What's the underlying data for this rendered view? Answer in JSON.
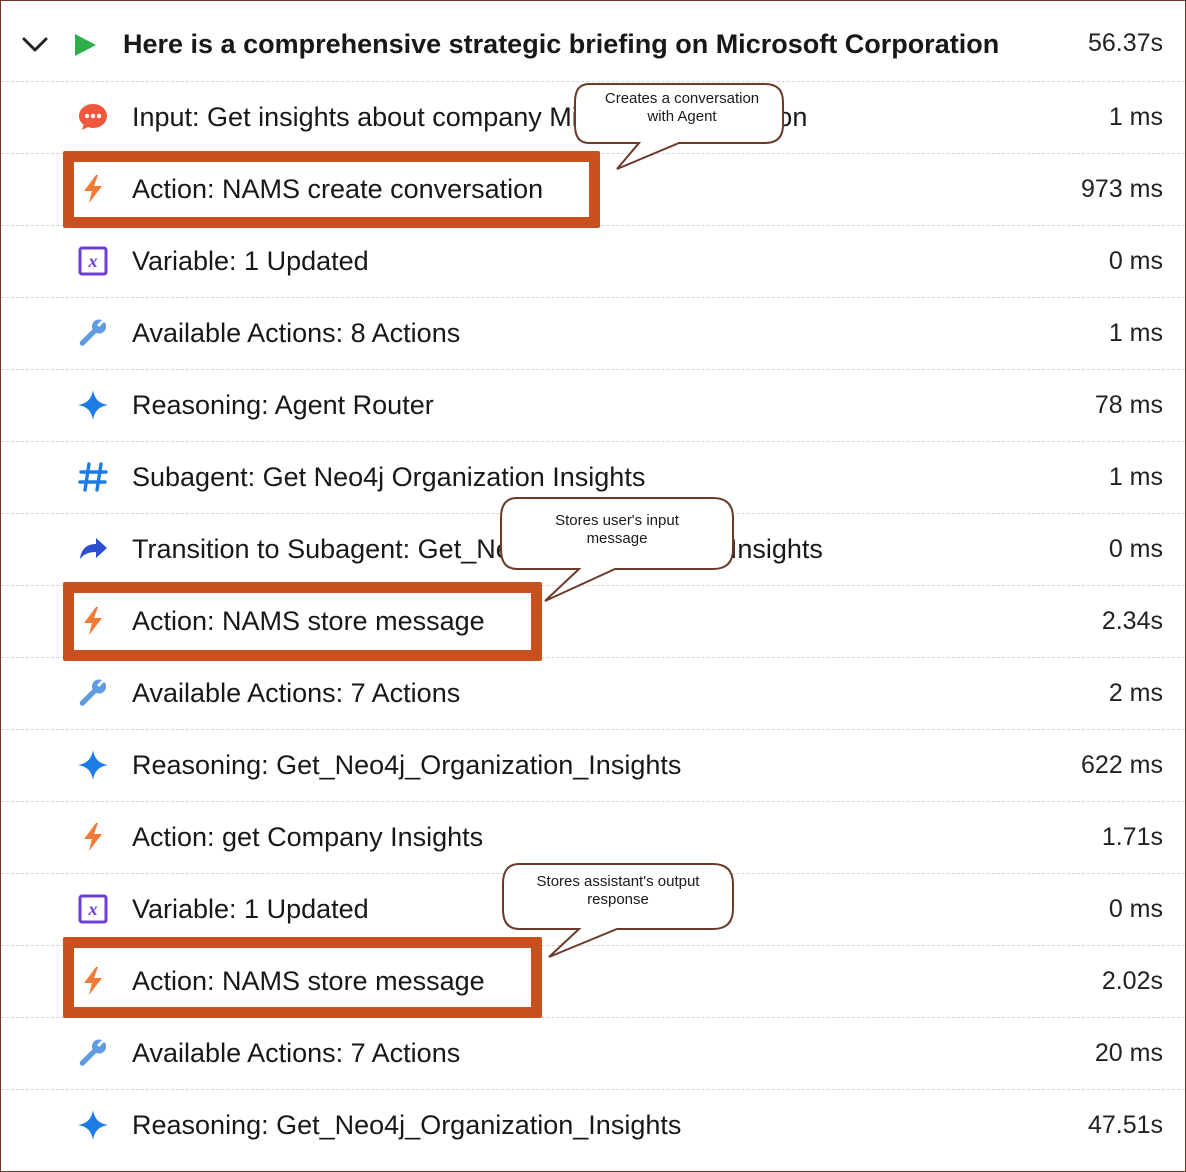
{
  "header": {
    "title": "Here is a comprehensive strategic briefing on Microsoft Corporation",
    "time": "56.37s",
    "expand_icon": "chevron-down-icon",
    "run_icon": "play-icon"
  },
  "rows": [
    {
      "label": "Input: Get insights about company Microsoft Corporation",
      "time": "1 ms",
      "icon": "chat-icon"
    },
    {
      "label": "Action: NAMS create conversation",
      "time": "973 ms",
      "icon": "lightning-icon"
    },
    {
      "label": "Variable: 1 Updated",
      "time": "0 ms",
      "icon": "variable-icon"
    },
    {
      "label": "Available Actions: 8 Actions",
      "time": "1 ms",
      "icon": "wrench-icon"
    },
    {
      "label": "Reasoning: Agent Router",
      "time": "78 ms",
      "icon": "sparkle-icon"
    },
    {
      "label": "Subagent: Get Neo4j Organization Insights",
      "time": "1 ms",
      "icon": "hash-icon"
    },
    {
      "label": "Transition to Subagent: Get_Neo4j_Organization_Insights",
      "time": "0 ms",
      "icon": "redirect-arrow-icon"
    },
    {
      "label": "Action: NAMS store message",
      "time": "2.34s",
      "icon": "lightning-icon"
    },
    {
      "label": "Available Actions: 7 Actions",
      "time": "2 ms",
      "icon": "wrench-icon"
    },
    {
      "label": "Reasoning: Get_Neo4j_Organization_Insights",
      "time": "622 ms",
      "icon": "sparkle-icon"
    },
    {
      "label": "Action: get Company Insights",
      "time": "1.71s",
      "icon": "lightning-icon"
    },
    {
      "label": "Variable: 1 Updated",
      "time": "0 ms",
      "icon": "variable-icon"
    },
    {
      "label": "Action: NAMS store message",
      "time": "2.02s",
      "icon": "lightning-icon"
    },
    {
      "label": "Available Actions: 7 Actions",
      "time": "20 ms",
      "icon": "wrench-icon"
    },
    {
      "label": "Reasoning: Get_Neo4j_Organization_Insights",
      "time": "47.51s",
      "icon": "sparkle-icon"
    }
  ],
  "callouts": [
    {
      "line1": "Creates a conversation",
      "line2": "with Agent"
    },
    {
      "line1": "Stores user's input",
      "line2": "message"
    },
    {
      "line1": "Stores assistant's output",
      "line2": "response"
    }
  ],
  "colors": {
    "highlight": "#c9511f",
    "action": "#f07a36",
    "reasoning": "#1b7ce8",
    "variable": "#6b3fd6",
    "wrench": "#5e9be2",
    "chat": "#f0573c",
    "play": "#2fae4a"
  }
}
